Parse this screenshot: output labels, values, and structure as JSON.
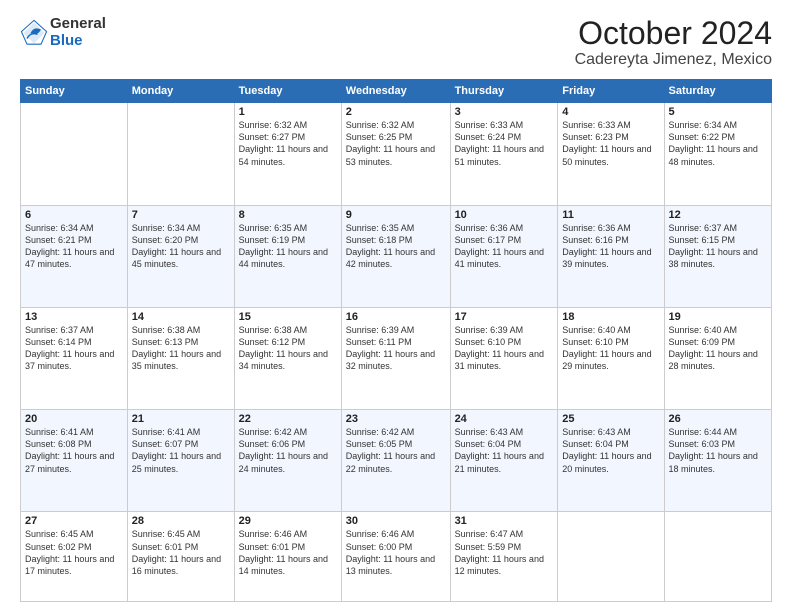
{
  "header": {
    "logo": {
      "general": "General",
      "blue": "Blue"
    },
    "month": "October 2024",
    "location": "Cadereyta Jimenez, Mexico"
  },
  "days_of_week": [
    "Sunday",
    "Monday",
    "Tuesday",
    "Wednesday",
    "Thursday",
    "Friday",
    "Saturday"
  ],
  "weeks": [
    [
      {
        "day": "",
        "sunrise": "",
        "sunset": "",
        "daylight": ""
      },
      {
        "day": "",
        "sunrise": "",
        "sunset": "",
        "daylight": ""
      },
      {
        "day": "1",
        "sunrise": "Sunrise: 6:32 AM",
        "sunset": "Sunset: 6:27 PM",
        "daylight": "Daylight: 11 hours and 54 minutes."
      },
      {
        "day": "2",
        "sunrise": "Sunrise: 6:32 AM",
        "sunset": "Sunset: 6:25 PM",
        "daylight": "Daylight: 11 hours and 53 minutes."
      },
      {
        "day": "3",
        "sunrise": "Sunrise: 6:33 AM",
        "sunset": "Sunset: 6:24 PM",
        "daylight": "Daylight: 11 hours and 51 minutes."
      },
      {
        "day": "4",
        "sunrise": "Sunrise: 6:33 AM",
        "sunset": "Sunset: 6:23 PM",
        "daylight": "Daylight: 11 hours and 50 minutes."
      },
      {
        "day": "5",
        "sunrise": "Sunrise: 6:34 AM",
        "sunset": "Sunset: 6:22 PM",
        "daylight": "Daylight: 11 hours and 48 minutes."
      }
    ],
    [
      {
        "day": "6",
        "sunrise": "Sunrise: 6:34 AM",
        "sunset": "Sunset: 6:21 PM",
        "daylight": "Daylight: 11 hours and 47 minutes."
      },
      {
        "day": "7",
        "sunrise": "Sunrise: 6:34 AM",
        "sunset": "Sunset: 6:20 PM",
        "daylight": "Daylight: 11 hours and 45 minutes."
      },
      {
        "day": "8",
        "sunrise": "Sunrise: 6:35 AM",
        "sunset": "Sunset: 6:19 PM",
        "daylight": "Daylight: 11 hours and 44 minutes."
      },
      {
        "day": "9",
        "sunrise": "Sunrise: 6:35 AM",
        "sunset": "Sunset: 6:18 PM",
        "daylight": "Daylight: 11 hours and 42 minutes."
      },
      {
        "day": "10",
        "sunrise": "Sunrise: 6:36 AM",
        "sunset": "Sunset: 6:17 PM",
        "daylight": "Daylight: 11 hours and 41 minutes."
      },
      {
        "day": "11",
        "sunrise": "Sunrise: 6:36 AM",
        "sunset": "Sunset: 6:16 PM",
        "daylight": "Daylight: 11 hours and 39 minutes."
      },
      {
        "day": "12",
        "sunrise": "Sunrise: 6:37 AM",
        "sunset": "Sunset: 6:15 PM",
        "daylight": "Daylight: 11 hours and 38 minutes."
      }
    ],
    [
      {
        "day": "13",
        "sunrise": "Sunrise: 6:37 AM",
        "sunset": "Sunset: 6:14 PM",
        "daylight": "Daylight: 11 hours and 37 minutes."
      },
      {
        "day": "14",
        "sunrise": "Sunrise: 6:38 AM",
        "sunset": "Sunset: 6:13 PM",
        "daylight": "Daylight: 11 hours and 35 minutes."
      },
      {
        "day": "15",
        "sunrise": "Sunrise: 6:38 AM",
        "sunset": "Sunset: 6:12 PM",
        "daylight": "Daylight: 11 hours and 34 minutes."
      },
      {
        "day": "16",
        "sunrise": "Sunrise: 6:39 AM",
        "sunset": "Sunset: 6:11 PM",
        "daylight": "Daylight: 11 hours and 32 minutes."
      },
      {
        "day": "17",
        "sunrise": "Sunrise: 6:39 AM",
        "sunset": "Sunset: 6:10 PM",
        "daylight": "Daylight: 11 hours and 31 minutes."
      },
      {
        "day": "18",
        "sunrise": "Sunrise: 6:40 AM",
        "sunset": "Sunset: 6:10 PM",
        "daylight": "Daylight: 11 hours and 29 minutes."
      },
      {
        "day": "19",
        "sunrise": "Sunrise: 6:40 AM",
        "sunset": "Sunset: 6:09 PM",
        "daylight": "Daylight: 11 hours and 28 minutes."
      }
    ],
    [
      {
        "day": "20",
        "sunrise": "Sunrise: 6:41 AM",
        "sunset": "Sunset: 6:08 PM",
        "daylight": "Daylight: 11 hours and 27 minutes."
      },
      {
        "day": "21",
        "sunrise": "Sunrise: 6:41 AM",
        "sunset": "Sunset: 6:07 PM",
        "daylight": "Daylight: 11 hours and 25 minutes."
      },
      {
        "day": "22",
        "sunrise": "Sunrise: 6:42 AM",
        "sunset": "Sunset: 6:06 PM",
        "daylight": "Daylight: 11 hours and 24 minutes."
      },
      {
        "day": "23",
        "sunrise": "Sunrise: 6:42 AM",
        "sunset": "Sunset: 6:05 PM",
        "daylight": "Daylight: 11 hours and 22 minutes."
      },
      {
        "day": "24",
        "sunrise": "Sunrise: 6:43 AM",
        "sunset": "Sunset: 6:04 PM",
        "daylight": "Daylight: 11 hours and 21 minutes."
      },
      {
        "day": "25",
        "sunrise": "Sunrise: 6:43 AM",
        "sunset": "Sunset: 6:04 PM",
        "daylight": "Daylight: 11 hours and 20 minutes."
      },
      {
        "day": "26",
        "sunrise": "Sunrise: 6:44 AM",
        "sunset": "Sunset: 6:03 PM",
        "daylight": "Daylight: 11 hours and 18 minutes."
      }
    ],
    [
      {
        "day": "27",
        "sunrise": "Sunrise: 6:45 AM",
        "sunset": "Sunset: 6:02 PM",
        "daylight": "Daylight: 11 hours and 17 minutes."
      },
      {
        "day": "28",
        "sunrise": "Sunrise: 6:45 AM",
        "sunset": "Sunset: 6:01 PM",
        "daylight": "Daylight: 11 hours and 16 minutes."
      },
      {
        "day": "29",
        "sunrise": "Sunrise: 6:46 AM",
        "sunset": "Sunset: 6:01 PM",
        "daylight": "Daylight: 11 hours and 14 minutes."
      },
      {
        "day": "30",
        "sunrise": "Sunrise: 6:46 AM",
        "sunset": "Sunset: 6:00 PM",
        "daylight": "Daylight: 11 hours and 13 minutes."
      },
      {
        "day": "31",
        "sunrise": "Sunrise: 6:47 AM",
        "sunset": "Sunset: 5:59 PM",
        "daylight": "Daylight: 11 hours and 12 minutes."
      },
      {
        "day": "",
        "sunrise": "",
        "sunset": "",
        "daylight": ""
      },
      {
        "day": "",
        "sunrise": "",
        "sunset": "",
        "daylight": ""
      }
    ]
  ]
}
